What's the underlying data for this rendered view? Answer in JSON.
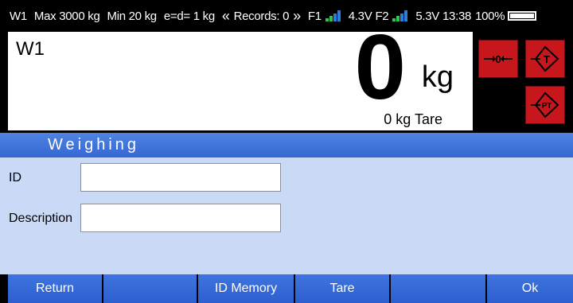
{
  "status": {
    "scale_name": "W1",
    "max_capacity": "Max 3000 kg",
    "min_capacity": "Min 20 kg",
    "division": "e=d= 1 kg",
    "records_prefix": "«",
    "records": "Records: 0",
    "records_suffix": "»",
    "f1_label": "F1",
    "f1_voltage": "4.3V",
    "f2_label": "F2",
    "f2_voltage": "5.3V",
    "time": "13:38",
    "battery": "100%"
  },
  "display": {
    "scale_name": "W1",
    "weight": "0",
    "unit": "kg",
    "tare": "0 kg Tare"
  },
  "keys": {
    "zero_icon": "zero-key-icon",
    "tare_icon": "tare-key-icon",
    "preset_tare_icon": "preset-tare-key-icon",
    "zero_text": "0",
    "tare_text": "T",
    "preset_tare_text": "PT"
  },
  "form": {
    "title": "Weighing",
    "id_label": "ID",
    "id_value": "",
    "description_label": "Description",
    "description_value": ""
  },
  "function_keys": {
    "f1": "Return",
    "f2": "",
    "f3": "ID Memory",
    "f4": "Tare",
    "f5": "",
    "f6": "Ok"
  },
  "colors": {
    "accent_blue": "#3567d2",
    "panel_bg": "#cad9f5",
    "key_red": "#c8161d"
  }
}
